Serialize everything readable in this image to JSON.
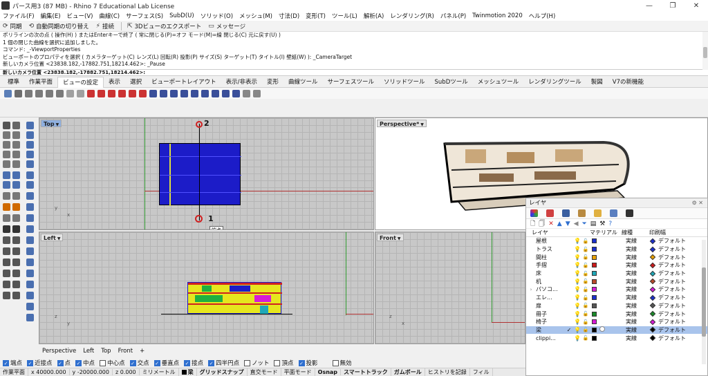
{
  "window": {
    "title": "パース用3 (87 MB) - Rhino 7 Educational Lab License",
    "controls": [
      "—",
      "❐",
      "✕"
    ]
  },
  "menu": [
    "ファイル(F)",
    "編集(E)",
    "ビュー(V)",
    "曲線(C)",
    "サーフェス(S)",
    "SubD(U)",
    "ソリッド(O)",
    "メッシュ(M)",
    "寸法(D)",
    "変形(T)",
    "ツール(L)",
    "解析(A)",
    "レンダリング(R)",
    "パネル(P)",
    "Twinmotion 2020",
    "ヘルプ(H)"
  ],
  "quickbar": {
    "sync": "同期",
    "autosync": "自動同期の切り替え",
    "connect": "接続",
    "export3d": "3Dビューのエクスポート",
    "message": "メッセージ"
  },
  "command": {
    "lines": [
      "ポリラインの次の点 ( 操作(H) ) またはEnterキーで終了 ( 常に閉じる(P)=オフ モード(M)=線 閉じる(C) 元に戻す(U) )",
      "1 個の閉じた曲線を選択に追加しました。",
      "コマンド: _-ViewportProperties",
      "ビューポートのプロパティを選択 ( カメラターゲット(C) レンズ(L) 回転(R) 投影(P) サイズ(S) ターゲット(T) タイトル(I) 壁紙(W) ): _CameraTarget",
      "新しいカメラ位置 <23838.182,-17882.751,18214.462>: _Pause"
    ],
    "prompt": "新しいカメラ位置 <23838.182,-17882.751,18214.462>:"
  },
  "tabs": [
    "標準",
    "作業平面",
    "ビューの設定",
    "表示",
    "選択",
    "ビューポートレイアウト",
    "表示/非表示",
    "変形",
    "曲線ツール",
    "サーフェスツール",
    "ソリッドツール",
    "SubDツール",
    "メッシュツール",
    "レンダリングツール",
    "製図",
    "V7の新機能"
  ],
  "active_tab": "ビューの設定",
  "viewports": {
    "top": {
      "title": "Top",
      "marker1": "1",
      "marker2": "2",
      "tooltip": "端点"
    },
    "perspective": {
      "title": "Perspective*"
    },
    "left": {
      "title": "Left"
    },
    "front": {
      "title": "Front"
    }
  },
  "axes": {
    "x": "x",
    "y": "y",
    "z": "z"
  },
  "viewport_tabs": [
    "Perspective",
    "Left",
    "Top",
    "Front",
    "+"
  ],
  "layers_panel": {
    "title": "レイヤ",
    "col_layer": "レイヤ",
    "col_material": "マテリアル",
    "col_linetype": "線種",
    "col_printwidth": "印刷幅",
    "rows": [
      {
        "name": "屋根",
        "color": "#1b2fcc",
        "linetype": "実線",
        "pw_color": "#1b2fcc",
        "pw": "デフォルト",
        "expand": ""
      },
      {
        "name": "トラス",
        "color": "#1b2fcc",
        "linetype": "実線",
        "pw_color": "#1b2fcc",
        "pw": "デフォルト",
        "expand": ""
      },
      {
        "name": "間柱",
        "color": "#e8a000",
        "linetype": "実線",
        "pw_color": "#e8a000",
        "pw": "デフォルト",
        "expand": ""
      },
      {
        "name": "手摺",
        "color": "#cc1b1b",
        "linetype": "実線",
        "pw_color": "#cc1b1b",
        "pw": "デフォルト",
        "expand": ""
      },
      {
        "name": "床",
        "color": "#1fa8b8",
        "linetype": "実線",
        "pw_color": "#1fa8b8",
        "pw": "デフォルト",
        "expand": ""
      },
      {
        "name": "机",
        "color": "#b84a2a",
        "linetype": "実線",
        "pw_color": "#b84a2a",
        "pw": "デフォルト",
        "expand": ""
      },
      {
        "name": "パソコ...",
        "color": "#d61bd6",
        "linetype": "実線",
        "pw_color": "#d61bd6",
        "pw": "デフォルト",
        "expand": "›"
      },
      {
        "name": "エレ...",
        "color": "#1b2fcc",
        "linetype": "実線",
        "pw_color": "#1b2fcc",
        "pw": "デフォルト",
        "expand": ""
      },
      {
        "name": "扉",
        "color": "#555555",
        "linetype": "実線",
        "pw_color": "#555555",
        "pw": "デフォルト",
        "expand": ""
      },
      {
        "name": "冊子",
        "color": "#1a8a2a",
        "linetype": "実線",
        "pw_color": "#1a8a2a",
        "pw": "デフォルト",
        "expand": ""
      },
      {
        "name": "椅子",
        "color": "#d61bd6",
        "linetype": "実線",
        "pw_color": "#d61bd6",
        "pw": "デフォルト",
        "expand": ""
      },
      {
        "name": "梁",
        "color": "#000000",
        "linetype": "実線",
        "pw_color": "#000000",
        "pw": "デフォルト",
        "expand": "",
        "selected": true,
        "current": "✓"
      },
      {
        "name": "clippi...",
        "color": "#000000",
        "linetype": "実線",
        "pw_color": "#000000",
        "pw": "デフォルト",
        "expand": ""
      }
    ]
  },
  "osnap": [
    {
      "label": "端点",
      "on": true
    },
    {
      "label": "近接点",
      "on": true
    },
    {
      "label": "点",
      "on": true
    },
    {
      "label": "中点",
      "on": true
    },
    {
      "label": "中心点",
      "on": false
    },
    {
      "label": "交点",
      "on": true
    },
    {
      "label": "垂直点",
      "on": true
    },
    {
      "label": "接点",
      "on": true
    },
    {
      "label": "四半円点",
      "on": true
    },
    {
      "label": "ノット",
      "on": false
    },
    {
      "label": "頂点",
      "on": false
    },
    {
      "label": "投影",
      "on": true
    },
    {
      "label": "無効",
      "on": false
    }
  ],
  "status": {
    "cplane": "作業平面",
    "x": "x 40000.000",
    "y": "y -20000.000",
    "z": "z 0.000",
    "unit": "ミリメートル",
    "layer": "梁",
    "gridsnap": "グリッドスナップ",
    "ortho": "直交モード",
    "planar": "平面モード",
    "osnap": "Osnap",
    "smarttrack": "スマートトラック",
    "gumball": "ガムボール",
    "history": "ヒストリを記録",
    "filter": "フィル"
  },
  "colors": {
    "top_plan": "#1c1cc8",
    "axis_red": "#b03030",
    "axis_green": "#2f9a2f",
    "accent": "#2f6fcf"
  }
}
